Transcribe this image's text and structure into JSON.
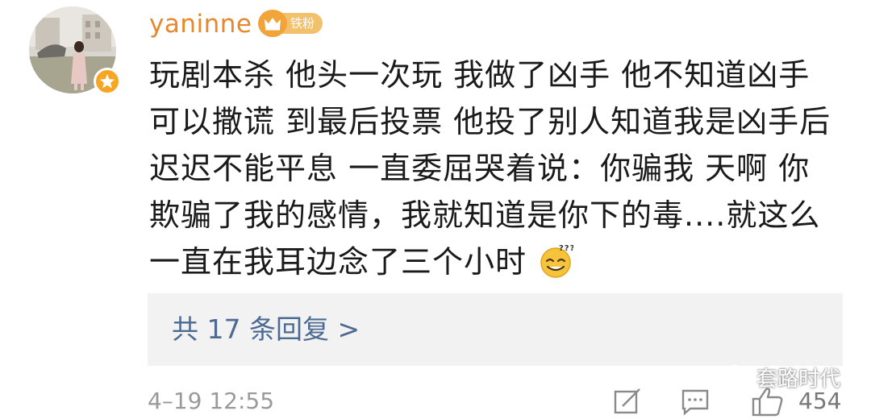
{
  "user": {
    "name": "yaninne",
    "fan_badge": "铁粉"
  },
  "comment": {
    "lines": [
      "玩剧本杀 他头一次玩 我做了凶手 他不知道凶手",
      "可以撒谎 到最后投票 他投了别人知道我是凶手后",
      "迟迟不能平息 一直委屈哭着说：你骗我 天啊 你",
      "欺骗了我的感情，我就知道是你下的毒....就这么",
      "一直在我耳边念了三个小时"
    ],
    "emoji": "doge-sweat-emoji"
  },
  "replies": {
    "label": "共 17 条回复 >"
  },
  "footer": {
    "timestamp": "4–19 12:55",
    "like_count": "454",
    "watermark": "套路时代"
  },
  "colors": {
    "username": "#e8872b",
    "link": "#4d6a93",
    "reply_bg": "#f2f2f2",
    "muted": "#9a9a9a"
  }
}
